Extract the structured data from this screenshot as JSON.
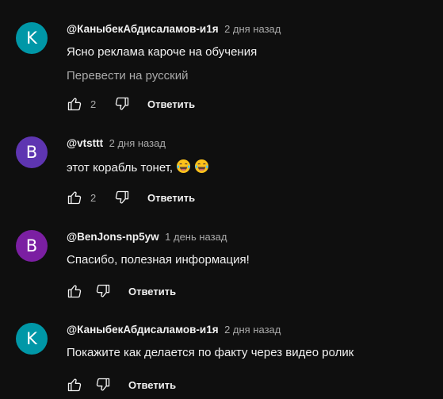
{
  "comments": [
    {
      "avatar_letter": "K",
      "avatar_color": "#0097a7",
      "author": "@КаныбекАбдисаламов-и1я",
      "time": "2 дня назад",
      "text": "Ясно реклама кароче на обучения",
      "translate_label": "Перевести на русский",
      "likes": "2",
      "reply_label": "Ответить"
    },
    {
      "avatar_letter": "B",
      "avatar_color": "#5e35b1",
      "author": "@vtsttt",
      "time": "2 дня назад",
      "text": "этот корабль тонет,",
      "emoji": [
        "face-with-tears-of-joy",
        "face-with-tears-of-joy"
      ],
      "likes": "2",
      "reply_label": "Ответить"
    },
    {
      "avatar_letter": "B",
      "avatar_color": "#7b1fa2",
      "author": "@BenJons-np5yw",
      "time": "1 день назад",
      "text": "Спасибо, полезная информация!",
      "likes": "",
      "reply_label": "Ответить"
    },
    {
      "avatar_letter": "K",
      "avatar_color": "#0097a7",
      "author": "@КаныбекАбдисаламов-и1я",
      "time": "2 дня назад",
      "text": "Покажите как делается по факту через видео ролик",
      "likes": "",
      "reply_label": "Ответить"
    }
  ]
}
